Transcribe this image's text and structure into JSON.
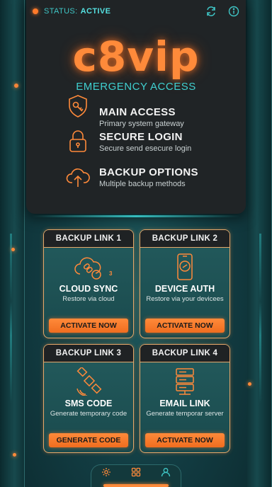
{
  "status": {
    "label": "STATUS:",
    "value": "ACTIVE"
  },
  "brand": {
    "logo": "c8vip",
    "subtitle": "EMERGENCY ACCESS"
  },
  "menu": [
    {
      "title": "MAIN ACCESS",
      "desc": "Primary system gateway",
      "icon": "shield-key-icon"
    },
    {
      "title": "SECURE LOGIN",
      "desc": "Secure send esecure login",
      "icon": "lock-icon"
    },
    {
      "title": "BACKUP OPTIONS",
      "desc": "Multiple backup methods",
      "icon": "cloud-upload-icon"
    }
  ],
  "cards": [
    {
      "header": "BACKUP LINK 1",
      "title": "CLOUD SYNC",
      "desc": "Restore via cloud",
      "button": "ACTIVATE NOW",
      "icon": "cloud-link-icon",
      "badge": "3"
    },
    {
      "header": "BACKUP LINK 2",
      "title": "DEVICE AUTH",
      "desc": "Restore via your devicees",
      "button": "ACTIVATE NOW",
      "icon": "phone-link-icon"
    },
    {
      "header": "BACKUP LINK 3",
      "title": "SMS CODE",
      "desc": "Generate temporary code",
      "button": "GENERATE CODE",
      "icon": "satellite-icon"
    },
    {
      "header": "BACKUP LINK 4",
      "title": "EMAIL LINK",
      "desc": "Generate temporar server",
      "button": "ACTIVATE NOW",
      "icon": "server-icon"
    }
  ],
  "nav": [
    "settings-icon",
    "grid-icon",
    "user-icon"
  ],
  "colors": {
    "accent": "#ff8a3a",
    "teal": "#40d0d0",
    "panel": "#202426"
  }
}
